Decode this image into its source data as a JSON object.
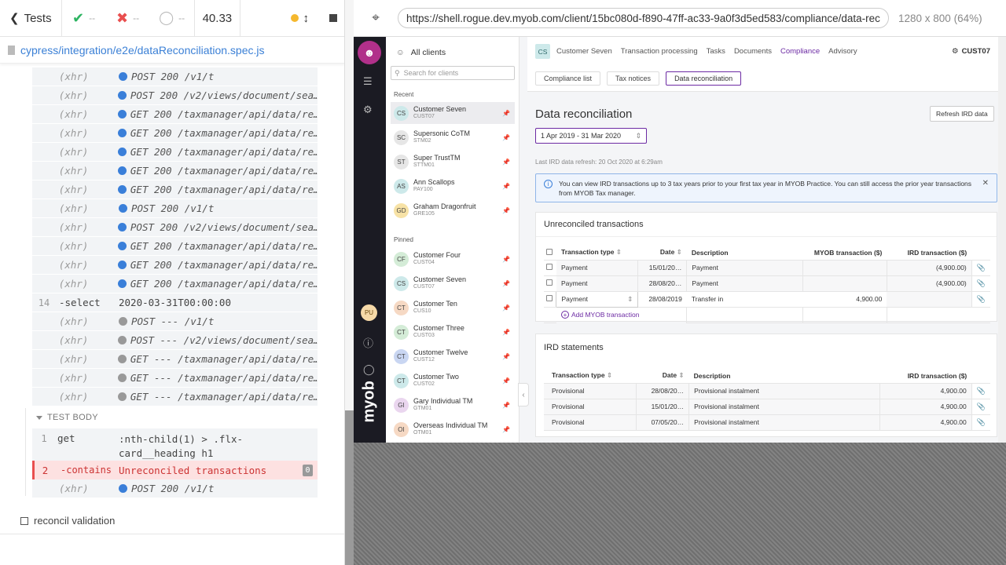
{
  "runner": {
    "tests_label": "Tests",
    "passed": "--",
    "failed": "--",
    "pending": "--",
    "duration": "40.33",
    "spec_path": "cypress/integration/e2e/dataReconciliation.spec.js",
    "commands": [
      {
        "num": "",
        "name": "(xhr)",
        "bullet": "blue",
        "msg": "POST 200 /v1/t"
      },
      {
        "num": "",
        "name": "(xhr)",
        "bullet": "blue",
        "msg": "POST 200 /v2/views/document/sea…"
      },
      {
        "num": "",
        "name": "(xhr)",
        "bullet": "blue",
        "msg": "GET 200 /taxmanager/api/data/re…"
      },
      {
        "num": "",
        "name": "(xhr)",
        "bullet": "blue",
        "msg": "GET 200 /taxmanager/api/data/re…"
      },
      {
        "num": "",
        "name": "(xhr)",
        "bullet": "blue",
        "msg": "GET 200 /taxmanager/api/data/re…"
      },
      {
        "num": "",
        "name": "(xhr)",
        "bullet": "blue",
        "msg": "GET 200 /taxmanager/api/data/re…"
      },
      {
        "num": "",
        "name": "(xhr)",
        "bullet": "blue",
        "msg": "GET 200 /taxmanager/api/data/re…"
      },
      {
        "num": "",
        "name": "(xhr)",
        "bullet": "blue",
        "msg": "POST 200 /v1/t"
      },
      {
        "num": "",
        "name": "(xhr)",
        "bullet": "blue",
        "msg": "POST 200 /v2/views/document/sea…"
      },
      {
        "num": "",
        "name": "(xhr)",
        "bullet": "blue",
        "msg": "GET 200 /taxmanager/api/data/re…"
      },
      {
        "num": "",
        "name": "(xhr)",
        "bullet": "blue",
        "msg": "GET 200 /taxmanager/api/data/re…"
      },
      {
        "num": "",
        "name": "(xhr)",
        "bullet": "blue",
        "msg": "GET 200 /taxmanager/api/data/re…"
      },
      {
        "num": "14",
        "name": "-select",
        "bullet": "",
        "msg": "2020-03-31T00:00:00",
        "plain": true
      },
      {
        "num": "",
        "name": "(xhr)",
        "bullet": "grey",
        "msg": "POST --- /v1/t"
      },
      {
        "num": "",
        "name": "(xhr)",
        "bullet": "grey",
        "msg": "POST --- /v2/views/document/sea…"
      },
      {
        "num": "",
        "name": "(xhr)",
        "bullet": "grey",
        "msg": "GET --- /taxmanager/api/data/re…"
      },
      {
        "num": "",
        "name": "(xhr)",
        "bullet": "grey",
        "msg": "GET --- /taxmanager/api/data/re…"
      },
      {
        "num": "",
        "name": "(xhr)",
        "bullet": "grey",
        "msg": "GET --- /taxmanager/api/data/re…"
      }
    ],
    "test_body_label": "TEST BODY",
    "body_cmd1": {
      "num": "1",
      "name": "get",
      "msg": ":nth-child(1) > .flx-card__heading h1"
    },
    "body_cmd2": {
      "num": "2",
      "name": "-contains",
      "msg": "Unreconciled transactions",
      "count": "0"
    },
    "body_cmd3": {
      "name": "(xhr)",
      "msg": "POST 200 /v1/t"
    },
    "next_test": "reconcil validation"
  },
  "browser": {
    "url": "https://shell.rogue.dev.myob.com/client/15bc080d-f890-47ff-ac33-9a0f3d5ed583/compliance/data-rec",
    "viewport": "1280 x 800",
    "scale": "(64%)"
  },
  "app": {
    "rail": {
      "user_initials": "PU",
      "logo": "myob"
    },
    "clients": {
      "all_label": "All clients",
      "search_placeholder": "Search for clients",
      "recent_label": "Recent",
      "pinned_label": "Pinned",
      "recent": [
        {
          "init": "CS",
          "name": "Customer Seven",
          "code": "CUST07",
          "color": "#cde9ea",
          "selected": true
        },
        {
          "init": "SC",
          "name": "Supersonic CoTM",
          "code": "STM02",
          "color": "#e6e6e6"
        },
        {
          "init": "ST",
          "name": "Super TrustTM",
          "code": "STTM01",
          "color": "#e6e6e6"
        },
        {
          "init": "AS",
          "name": "Ann Scallops",
          "code": "PAY100",
          "color": "#cde9ea"
        },
        {
          "init": "GD",
          "name": "Graham Dragonfruit",
          "code": "GRE105",
          "color": "#f7e2a6"
        }
      ],
      "pinned": [
        {
          "init": "CF",
          "name": "Customer Four",
          "code": "CUST04",
          "color": "#d4ecd7"
        },
        {
          "init": "CS",
          "name": "Customer Seven",
          "code": "CUST07",
          "color": "#cde9ea"
        },
        {
          "init": "CT",
          "name": "Customer Ten",
          "code": "CUS10",
          "color": "#f6d9c4"
        },
        {
          "init": "CT",
          "name": "Customer Three",
          "code": "CUST03",
          "color": "#d4ecd7"
        },
        {
          "init": "CT",
          "name": "Customer Twelve",
          "code": "CUST12",
          "color": "#c9d6f2"
        },
        {
          "init": "CT",
          "name": "Customer Two",
          "code": "CUST02",
          "color": "#cde9ea"
        },
        {
          "init": "GI",
          "name": "Gary Individual TM",
          "code": "GTM01",
          "color": "#ead6ef"
        },
        {
          "init": "OI",
          "name": "Overseas Individual TM",
          "code": "OTM01",
          "color": "#f6d9c4"
        }
      ]
    },
    "topnav": {
      "client_init": "CS",
      "client_name": "Customer Seven",
      "items": [
        "Transaction processing",
        "Tasks",
        "Documents",
        "Compliance",
        "Advisory"
      ],
      "right_label": "CUST07"
    },
    "subtabs": [
      "Compliance list",
      "Tax notices",
      "Data reconciliation"
    ],
    "page_title": "Data reconciliation",
    "refresh_label": "Refresh IRD data",
    "period": "1 Apr 2019 - 31 Mar 2020",
    "last_refresh": "Last IRD data refresh: 20 Oct 2020 at 6:29am",
    "info_text": "You can view IRD transactions up to 3 tax years prior to your first tax year in MYOB Practice. You can still access the prior year transactions from MYOB Tax manager.",
    "unrec": {
      "title": "Unreconciled transactions",
      "headers": [
        "Transaction type",
        "Date",
        "Description",
        "MYOB transaction ($)",
        "IRD transaction ($)"
      ],
      "rows": [
        {
          "type": "Payment",
          "date": "15/01/20…",
          "desc": "Payment",
          "myob": "",
          "ird": "(4,900.00)"
        },
        {
          "type": "Payment",
          "date": "28/08/20…",
          "desc": "Payment",
          "myob": "",
          "ird": "(4,900.00)"
        },
        {
          "type": "Payment",
          "date": "28/08/2019",
          "desc": "Transfer in",
          "myob": "4,900.00",
          "ird": ""
        }
      ],
      "add_label": "Add MYOB transaction"
    },
    "ird": {
      "title": "IRD statements",
      "headers": [
        "Transaction type",
        "Date",
        "Description",
        "IRD transaction ($)"
      ],
      "rows": [
        {
          "type": "Provisional",
          "date": "28/08/20…",
          "desc": "Provisional instalment",
          "ird": "4,900.00"
        },
        {
          "type": "Provisional",
          "date": "15/01/20…",
          "desc": "Provisional instalment",
          "ird": "4,900.00"
        },
        {
          "type": "Provisional",
          "date": "07/05/20…",
          "desc": "Provisional instalment",
          "ird": "4,900.00"
        }
      ]
    }
  }
}
